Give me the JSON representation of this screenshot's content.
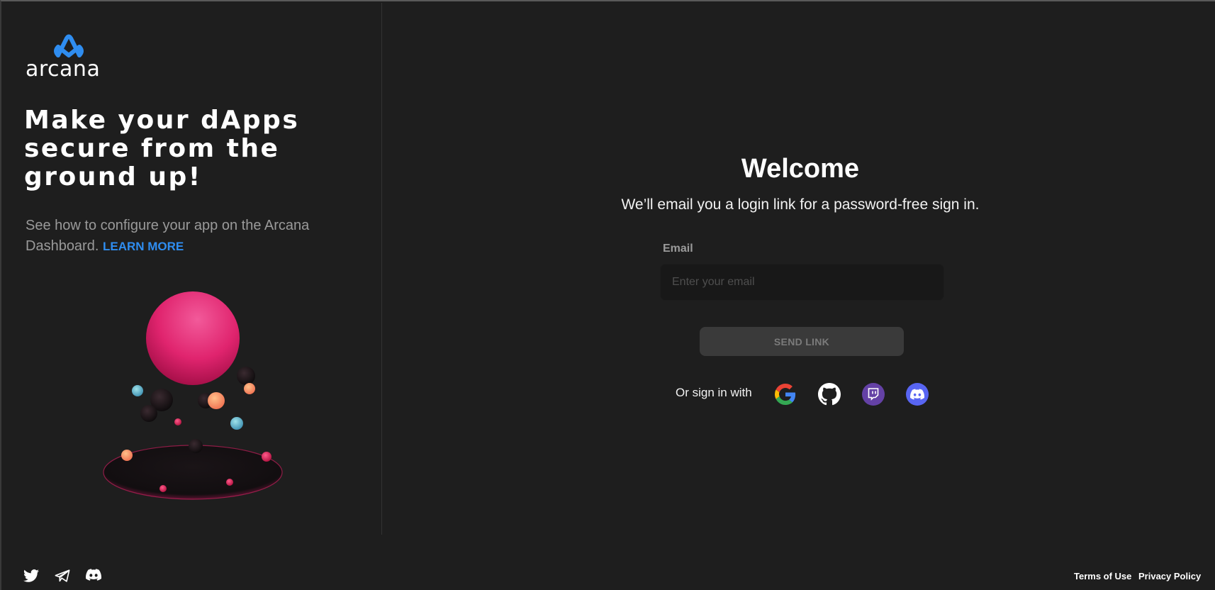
{
  "brand": {
    "name": "arcana",
    "accent": "#2f8df0"
  },
  "left": {
    "headline": "Make your dApps secure from the ground up!",
    "subtext": "See how to configure your app on the Arcana Dashboard.",
    "learn_more": "LEARN MORE"
  },
  "login": {
    "title": "Welcome",
    "subtitle": "We’ll email you a login link for a password-free sign in.",
    "email_label": "Email",
    "email_placeholder": "Enter your email",
    "email_value": "",
    "send_button": "SEND LINK",
    "or_sign_in": "Or sign in with",
    "providers": [
      "google-icon",
      "github-icon",
      "twitch-icon",
      "discord-icon"
    ]
  },
  "footer": {
    "social_icons": [
      "twitter-icon",
      "telegram-icon",
      "discord-icon"
    ],
    "terms": "Terms of Use",
    "privacy": "Privacy Policy"
  }
}
